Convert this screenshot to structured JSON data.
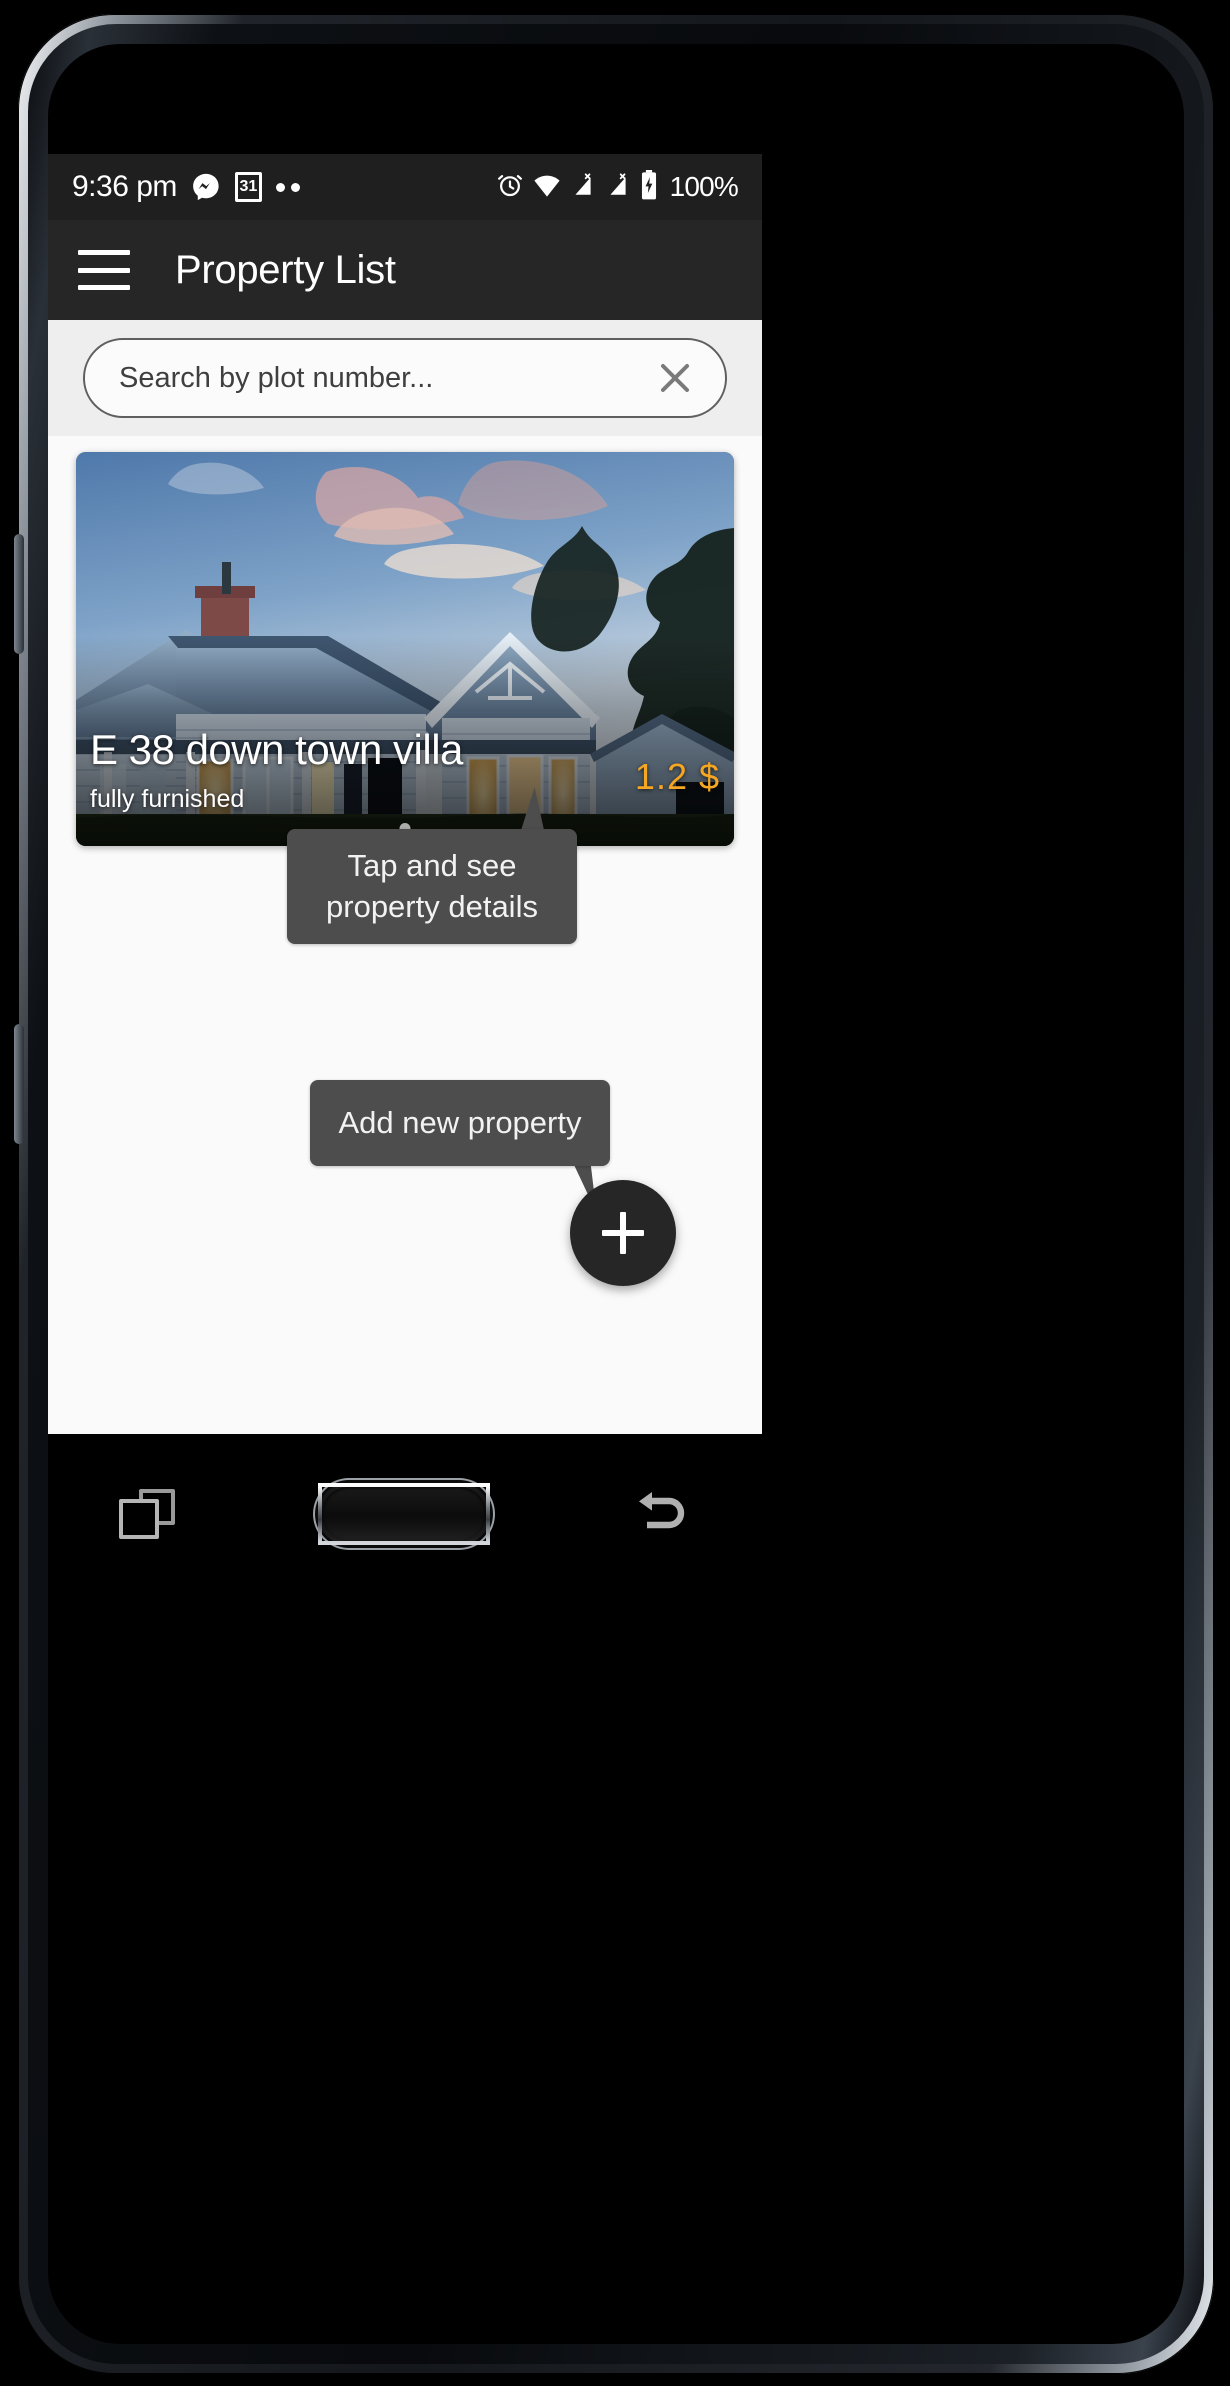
{
  "status_bar": {
    "time": "9:36 pm",
    "battery_percent": "100%",
    "calendar_day": "31",
    "icons": [
      "messenger-icon",
      "calendar-icon",
      "more-notifications-dots",
      "alarm-clock-icon",
      "wifi-icon",
      "sim1-signal-x-icon",
      "sim2-signal-x-icon",
      "battery-charging-icon"
    ]
  },
  "app_bar": {
    "menu_icon": "hamburger-menu-icon",
    "title": "Property List"
  },
  "search": {
    "value": "",
    "placeholder": "Search by plot number...",
    "clear_icon": "close-x-icon"
  },
  "property_card": {
    "title": "E 38 down town villa",
    "subtitle": "fully furnished",
    "price": "1.2 $",
    "price_color": "#f5a623",
    "page_dots": 1,
    "active_dot": 0,
    "image_alt": "two-storey pale blue weatherboard villa at dusk"
  },
  "tooltips": {
    "details": "Tap and see\nproperty details",
    "details_line1": "Tap and see",
    "details_line2": "property details",
    "add": "Add new property",
    "background_color": "#4d4d4d"
  },
  "fab": {
    "icon": "plus-icon",
    "label": "Add new property",
    "background_color": "#262626"
  },
  "nav_bar": {
    "recents_icon": "recents-squares-icon",
    "home_icon": "home-hardware-button",
    "back_icon": "back-arrow-icon"
  }
}
